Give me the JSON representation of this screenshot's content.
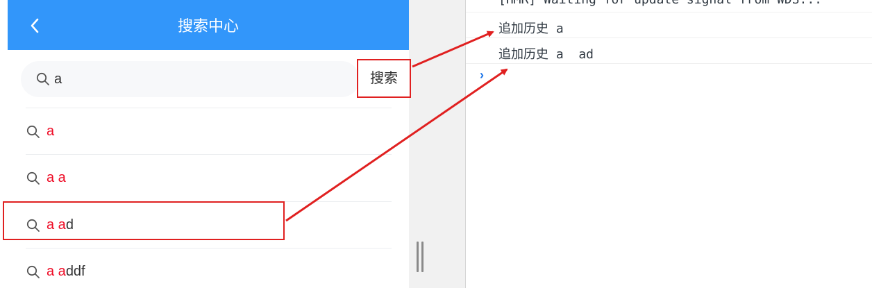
{
  "navbar": {
    "title": "搜索中心",
    "back_icon": "chevron-left-icon"
  },
  "search": {
    "value": "a",
    "button_label": "搜索"
  },
  "suggestions": [
    {
      "highlight": "a",
      "rest": ""
    },
    {
      "highlight": "a a",
      "rest": ""
    },
    {
      "highlight": "a a",
      "rest": "d"
    },
    {
      "highlight": "a a",
      "rest": "ddf"
    }
  ],
  "console": {
    "lines": [
      "[HMR] Waiting for update signal from WDS...",
      "追加历史 a",
      "追加历史 a  ad"
    ],
    "prompt": "›"
  },
  "colors": {
    "navbar": "#3296fa",
    "highlight": "#ee0a24",
    "annotation": "#e02020"
  }
}
